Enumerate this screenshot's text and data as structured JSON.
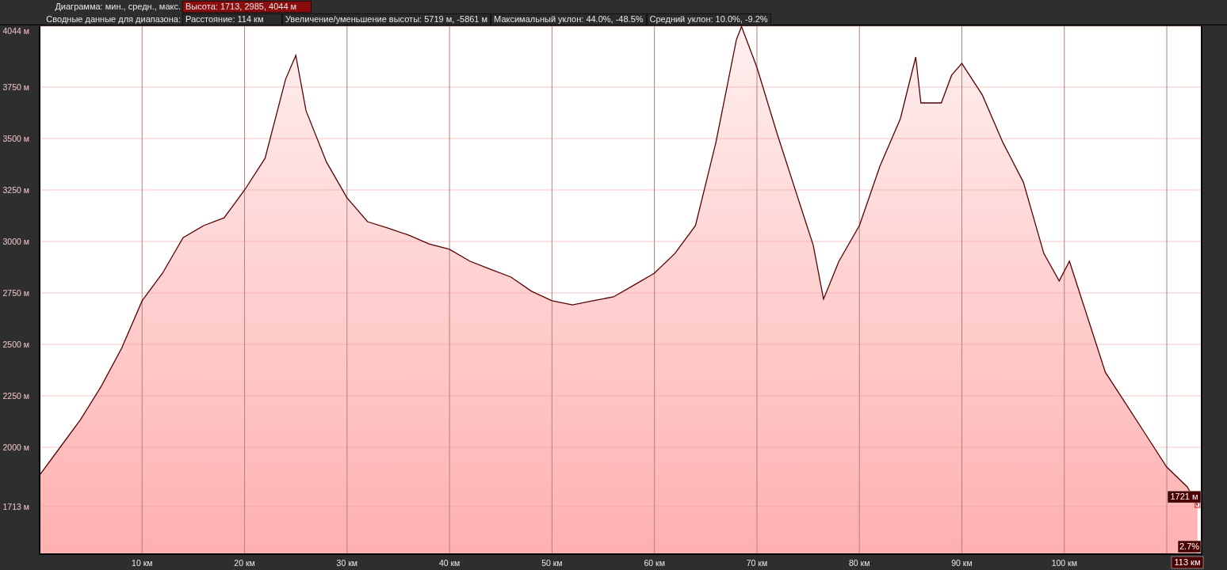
{
  "header": {
    "chart_row": {
      "label": "Диаграмма: мин., средн., макс.",
      "value": "Высота: 1713, 2985, 4044 м"
    },
    "summary_row": {
      "label": "Сводные данные для диапазона:",
      "items": [
        "Расстояние: 114 км",
        "Увеличение/уменьшение высоты: 5719 м, -5861 м",
        "Максимальный уклон: 44.0%, -48.5%",
        "Средний уклон: 10.0%, -9.2%"
      ]
    }
  },
  "profile": {
    "chart_data": {
      "type": "area",
      "x": [
        0,
        2,
        4,
        6,
        8,
        10,
        12,
        14,
        16,
        18,
        20,
        22,
        24,
        25,
        26,
        28,
        30,
        32,
        34,
        36,
        38,
        40,
        42,
        44,
        46,
        48,
        50,
        52,
        54,
        56,
        58,
        60,
        62,
        64,
        66,
        68,
        68.5,
        70,
        72,
        74,
        75.5,
        76.5,
        78,
        80,
        82,
        84,
        85.5,
        86,
        88,
        89,
        90,
        92,
        94,
        96,
        98,
        99.5,
        100.5,
        102,
        104,
        106,
        108,
        110,
        112,
        113
      ],
      "series": [
        {
          "color": "#5a0000",
          "values": [
            1865,
            2000,
            2135,
            2296,
            2481,
            2712,
            2846,
            3019,
            3077,
            3115,
            3250,
            3404,
            3788,
            3904,
            3635,
            3385,
            3212,
            3096,
            3065,
            3031,
            2988,
            2962,
            2904,
            2865,
            2827,
            2758,
            2712,
            2692,
            2712,
            2731,
            2788,
            2846,
            2942,
            3077,
            3481,
            3981,
            4044,
            3846,
            3519,
            3212,
            2981,
            2720,
            2904,
            3077,
            3365,
            3596,
            3896,
            3673,
            3673,
            3808,
            3865,
            3712,
            3481,
            3288,
            2942,
            2808,
            2904,
            2673,
            2365,
            2212,
            2058,
            1904,
            1808,
            1719
          ]
        }
      ],
      "xlim": [
        0,
        113.4
      ],
      "ylim": [
        1481,
        4046
      ],
      "xticks": [
        {
          "value": 10,
          "label": "10 км"
        },
        {
          "value": 20,
          "label": "20 км"
        },
        {
          "value": 30,
          "label": "30 км"
        },
        {
          "value": 40,
          "label": "40 км"
        },
        {
          "value": 50,
          "label": "50 км"
        },
        {
          "value": 60,
          "label": "60 км"
        },
        {
          "value": 70,
          "label": "70 км"
        },
        {
          "value": 80,
          "label": "80 км"
        },
        {
          "value": 90,
          "label": "90 км"
        },
        {
          "value": 100,
          "label": "100 км"
        }
      ],
      "grid": true,
      "yticks": [
        {
          "value": 4044,
          "label": "4044 м"
        },
        {
          "value": 3750,
          "label": "3750 м"
        },
        {
          "value": 3500,
          "label": "3500 м"
        },
        {
          "value": 3250,
          "label": "3250 м"
        },
        {
          "value": 3000,
          "label": "3000 м"
        },
        {
          "value": 2750,
          "label": "2750 м"
        },
        {
          "value": 2500,
          "label": "2500 м"
        },
        {
          "value": 2250,
          "label": "2250 м"
        },
        {
          "value": 2000,
          "label": "2000 м"
        },
        {
          "value": 1713,
          "label": "1713 м"
        }
      ]
    },
    "cursor": {
      "elevation": "1721 м",
      "grade": "2.7%",
      "distance": "113 км"
    }
  }
}
